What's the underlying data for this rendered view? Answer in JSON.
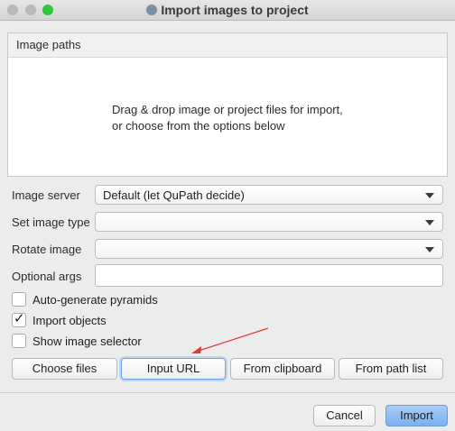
{
  "window": {
    "title": "Import images to project",
    "app_icon": "qupath-icon"
  },
  "image_paths": {
    "header": "Image paths",
    "hint_line1": "Drag & drop image or project files for import,",
    "hint_line2": "or choose from the options below"
  },
  "form": {
    "image_server": {
      "label": "Image server",
      "value": "Default (let QuPath decide)"
    },
    "set_image_type": {
      "label": "Set image type",
      "value": ""
    },
    "rotate_image": {
      "label": "Rotate image",
      "value": ""
    },
    "optional_args": {
      "label": "Optional args",
      "value": ""
    }
  },
  "checkboxes": [
    {
      "label": "Auto-generate pyramids",
      "checked": false
    },
    {
      "label": "Import objects",
      "checked": true
    },
    {
      "label": "Show image selector",
      "checked": false
    }
  ],
  "buttons": {
    "choose_files": "Choose files",
    "input_url": "Input URL",
    "from_clipboard": "From clipboard",
    "from_path_list": "From path list",
    "cancel": "Cancel",
    "import": "Import"
  },
  "colors": {
    "annotation_arrow": "#e0382b",
    "primary_button": "#7bb0ee",
    "focus_ring": "#6aa1e6"
  }
}
